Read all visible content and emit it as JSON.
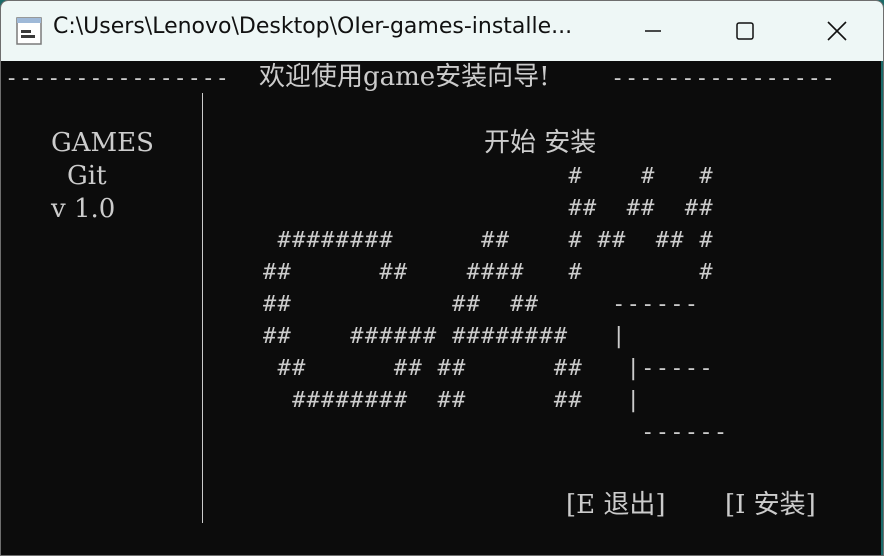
{
  "window": {
    "title": "C:\\Users\\Lenovo\\Desktop\\OIer-games-installe..."
  },
  "controls": {
    "minimize": "minimize",
    "maximize": "maximize",
    "close": "close"
  },
  "console": {
    "header_dashes_left": "----------------",
    "header_title": "欢迎使用game安装向导!",
    "header_dashes_right": "----------------",
    "sidebar": {
      "name": "GAMES",
      "sub": "Git",
      "version": "v 1.0"
    },
    "start_label": "开始 安装",
    "art": [
      "                     #    #   #",
      "                     ##  ##  ##",
      " ########      ##    # ##  ## #",
      "##      ##    ####   #        #",
      "##           ##  ##     ------",
      "##    ###### ########   |",
      " ##      ## ##      ##   |-----",
      "  ########  ##      ##   |",
      "                          ------"
    ],
    "exit_option": "[E 退出]",
    "install_option": "[I 安装]"
  }
}
